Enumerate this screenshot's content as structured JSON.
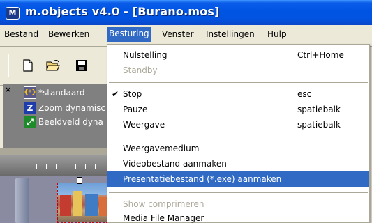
{
  "window": {
    "icon_text": "M",
    "title": "m.objects v4.0 - [Burano.mos]",
    "accent_color": "#0054e3"
  },
  "menubar": {
    "items": [
      {
        "label": "Bestand"
      },
      {
        "label": "Bewerken"
      },
      {
        "label": "Besturing",
        "active": true
      },
      {
        "label": "Venster"
      },
      {
        "label": "Instellingen"
      },
      {
        "label": "Hulp"
      }
    ]
  },
  "toolbar": {
    "buttons": [
      {
        "icon": "new-document-icon"
      },
      {
        "icon": "open-folder-icon"
      },
      {
        "icon": "save-disk-icon"
      }
    ]
  },
  "panel": {
    "close_glyph": "×",
    "rows": [
      {
        "icon": "standard-icon",
        "icon_text": "{*}",
        "label": "*standaard"
      },
      {
        "icon": "zoom-icon",
        "icon_text": "Z",
        "label": "Zoom dynamisc"
      },
      {
        "icon": "image-field-icon",
        "icon_text": "⤢",
        "label": "Beeldveld dyna"
      }
    ]
  },
  "dropdown": {
    "items": [
      {
        "label": "Nulstelling",
        "shortcut": "Ctrl+Home",
        "disabled": false
      },
      {
        "label": "Standby",
        "shortcut": "",
        "disabled": true
      },
      {
        "label": "Stop",
        "shortcut": "esc",
        "checked": true
      },
      {
        "label": "Pauze",
        "shortcut": "spatiebalk"
      },
      {
        "label": "Weergave",
        "shortcut": "spatiebalk"
      },
      {
        "label": "Weergavemedium",
        "shortcut": ""
      },
      {
        "label": "Videobestand aanmaken",
        "shortcut": ""
      },
      {
        "label": "Presentatiebestand (*.exe) aanmaken",
        "shortcut": "",
        "highlighted": true
      },
      {
        "label": "Show comprimeren",
        "shortcut": "",
        "disabled": true
      },
      {
        "label": "Media File Manager",
        "shortcut": ""
      }
    ],
    "check_glyph": "✔",
    "highlight_color": "#316ac5",
    "disabled_color": "#aca899"
  }
}
